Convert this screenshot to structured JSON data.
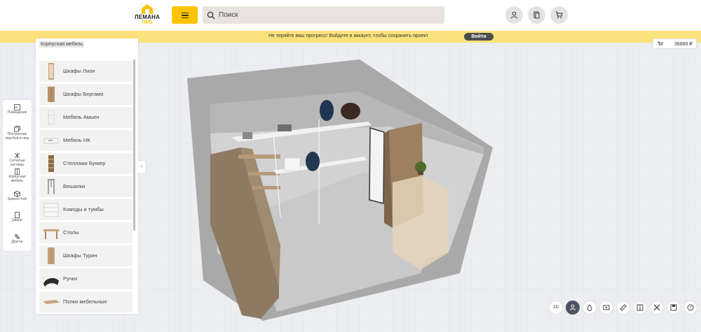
{
  "header": {
    "logo_text": "ЛЕМАНА",
    "logo_sub": "ПРО",
    "search_placeholder": "Поиск",
    "icons": [
      "user-icon",
      "catalog-icon",
      "cart-icon"
    ]
  },
  "banner": {
    "message": "Не теряйте ваш прогресс! Войдите в аккаунт, чтобы сохранить проект",
    "login_label": "Войти"
  },
  "price": {
    "value": "36886 ₽"
  },
  "toolbar": {
    "items": [
      {
        "label": "Помещения",
        "icon": "room-icon"
      },
      {
        "label": "Построение коробов и ниш",
        "icon": "box-icon"
      },
      {
        "label": "Сетчатые системы",
        "icon": "grid-icon"
      },
      {
        "label": "Корпусная мебель",
        "icon": "wardrobe-icon"
      },
      {
        "label": "Spaceo Kub",
        "icon": "cube-icon"
      },
      {
        "label": "Двери",
        "icon": "door-icon"
      },
      {
        "label": "Другое",
        "icon": "other-icon"
      }
    ]
  },
  "panel": {
    "section": "Корпусная мебель",
    "items": [
      {
        "label": "Шкафы Лион"
      },
      {
        "label": "Шкафы Бергамо"
      },
      {
        "label": "Мебель Амьен"
      },
      {
        "label": "Мебель НК"
      },
      {
        "label": "Стеллажи Буккер"
      },
      {
        "label": "Вешалки"
      },
      {
        "label": "Комоды и тумбы"
      },
      {
        "label": "Столы"
      },
      {
        "label": "Шкафы Турин"
      },
      {
        "label": "Ручки"
      },
      {
        "label": "Полки мебельные"
      }
    ]
  },
  "bottom_toolbar": {
    "mode_label": "2D",
    "icons": [
      "person-view-icon",
      "drop-icon",
      "video-icon",
      "ruler-icon",
      "split-icon",
      "tools-icon",
      "save-icon",
      "help-icon"
    ]
  },
  "colors": {
    "accent": "#fdc300",
    "banner": "#fce27c",
    "dark": "#4d4d4d"
  }
}
